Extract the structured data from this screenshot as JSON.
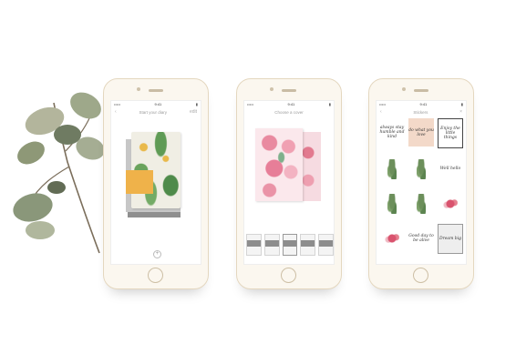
{
  "phones": [
    {
      "status": {
        "carrier": "•••••",
        "time": "9:41",
        "battery": "▮"
      },
      "nav": {
        "left": "‹",
        "title": "Start your diary",
        "right": "edit"
      },
      "add_button": "+"
    },
    {
      "status": {
        "carrier": "•••••",
        "time": "9:41",
        "battery": "▮"
      },
      "nav": {
        "left": "",
        "title": "Choose a cover",
        "right": ""
      }
    },
    {
      "status": {
        "carrier": "•••••",
        "time": "9:41",
        "battery": "▮"
      },
      "nav": {
        "left": "‹",
        "title": "Stickers",
        "right": "×"
      },
      "stickers": [
        {
          "text": "always stay humble and kind"
        },
        {
          "text": "do what you love"
        },
        {
          "text": "Enjoy the little things"
        },
        {
          "text": ""
        },
        {
          "text": ""
        },
        {
          "text": "Well hello"
        },
        {
          "text": ""
        },
        {
          "text": ""
        },
        {
          "text": ""
        },
        {
          "text": ""
        },
        {
          "text": "Good day to be alive"
        },
        {
          "text": "Dream big"
        }
      ]
    }
  ]
}
